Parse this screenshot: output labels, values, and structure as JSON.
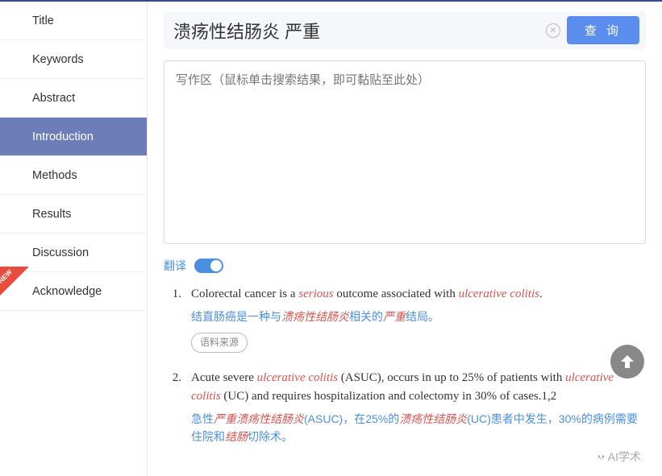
{
  "sidebar": {
    "items": [
      {
        "label": "Title"
      },
      {
        "label": "Keywords"
      },
      {
        "label": "Abstract"
      },
      {
        "label": "Introduction"
      },
      {
        "label": "Methods"
      },
      {
        "label": "Results"
      },
      {
        "label": "Discussion"
      },
      {
        "label": "Acknowledge"
      }
    ],
    "active_index": 3,
    "new_on_index": 7
  },
  "search": {
    "value": "溃疡性结肠炎 严重",
    "query_btn": "查 询"
  },
  "writing_area": {
    "placeholder": "写作区（鼠标单击搜索结果，即可黏贴至此处）"
  },
  "translate": {
    "label": "翻译",
    "on": true
  },
  "results": [
    {
      "num": "1.",
      "en_parts": [
        {
          "t": "Colorectal cancer is a ",
          "hl": false
        },
        {
          "t": "serious",
          "hl": true
        },
        {
          "t": " outcome associated with ",
          "hl": false
        },
        {
          "t": "ulcerative colitis",
          "hl": true
        },
        {
          "t": ".",
          "hl": false
        }
      ],
      "cn_parts": [
        {
          "t": "结直肠癌是一种与",
          "hl": false
        },
        {
          "t": "溃疡性结肠炎",
          "hl": true
        },
        {
          "t": "相关的",
          "hl": false
        },
        {
          "t": "严重",
          "hl": true
        },
        {
          "t": "结局。",
          "hl": false
        }
      ],
      "source_btn": "语料来源"
    },
    {
      "num": "2.",
      "en_parts": [
        {
          "t": "Acute severe ",
          "hl": false
        },
        {
          "t": "ulcerative colitis",
          "hl": true
        },
        {
          "t": " (ASUC), occurs in up to 25% of patients with ",
          "hl": false
        },
        {
          "t": "ulcerative colitis",
          "hl": true
        },
        {
          "t": " (UC) and requires hospitalization and colectomy in 30% of cases.1,2",
          "hl": false
        }
      ],
      "cn_parts": [
        {
          "t": "急性",
          "hl": false
        },
        {
          "t": "严重溃疡性结肠炎",
          "hl": true
        },
        {
          "t": "(ASUC)，在25%的",
          "hl": false
        },
        {
          "t": "溃疡性结肠炎",
          "hl": true
        },
        {
          "t": "(UC)患者中发生，30%的病例需要住院和",
          "hl": false
        },
        {
          "t": "结肠",
          "hl": true
        },
        {
          "t": "切除术。",
          "hl": false
        }
      ]
    }
  ],
  "misc": {
    "new_badge": "NEW",
    "watermark": "AI学术"
  }
}
